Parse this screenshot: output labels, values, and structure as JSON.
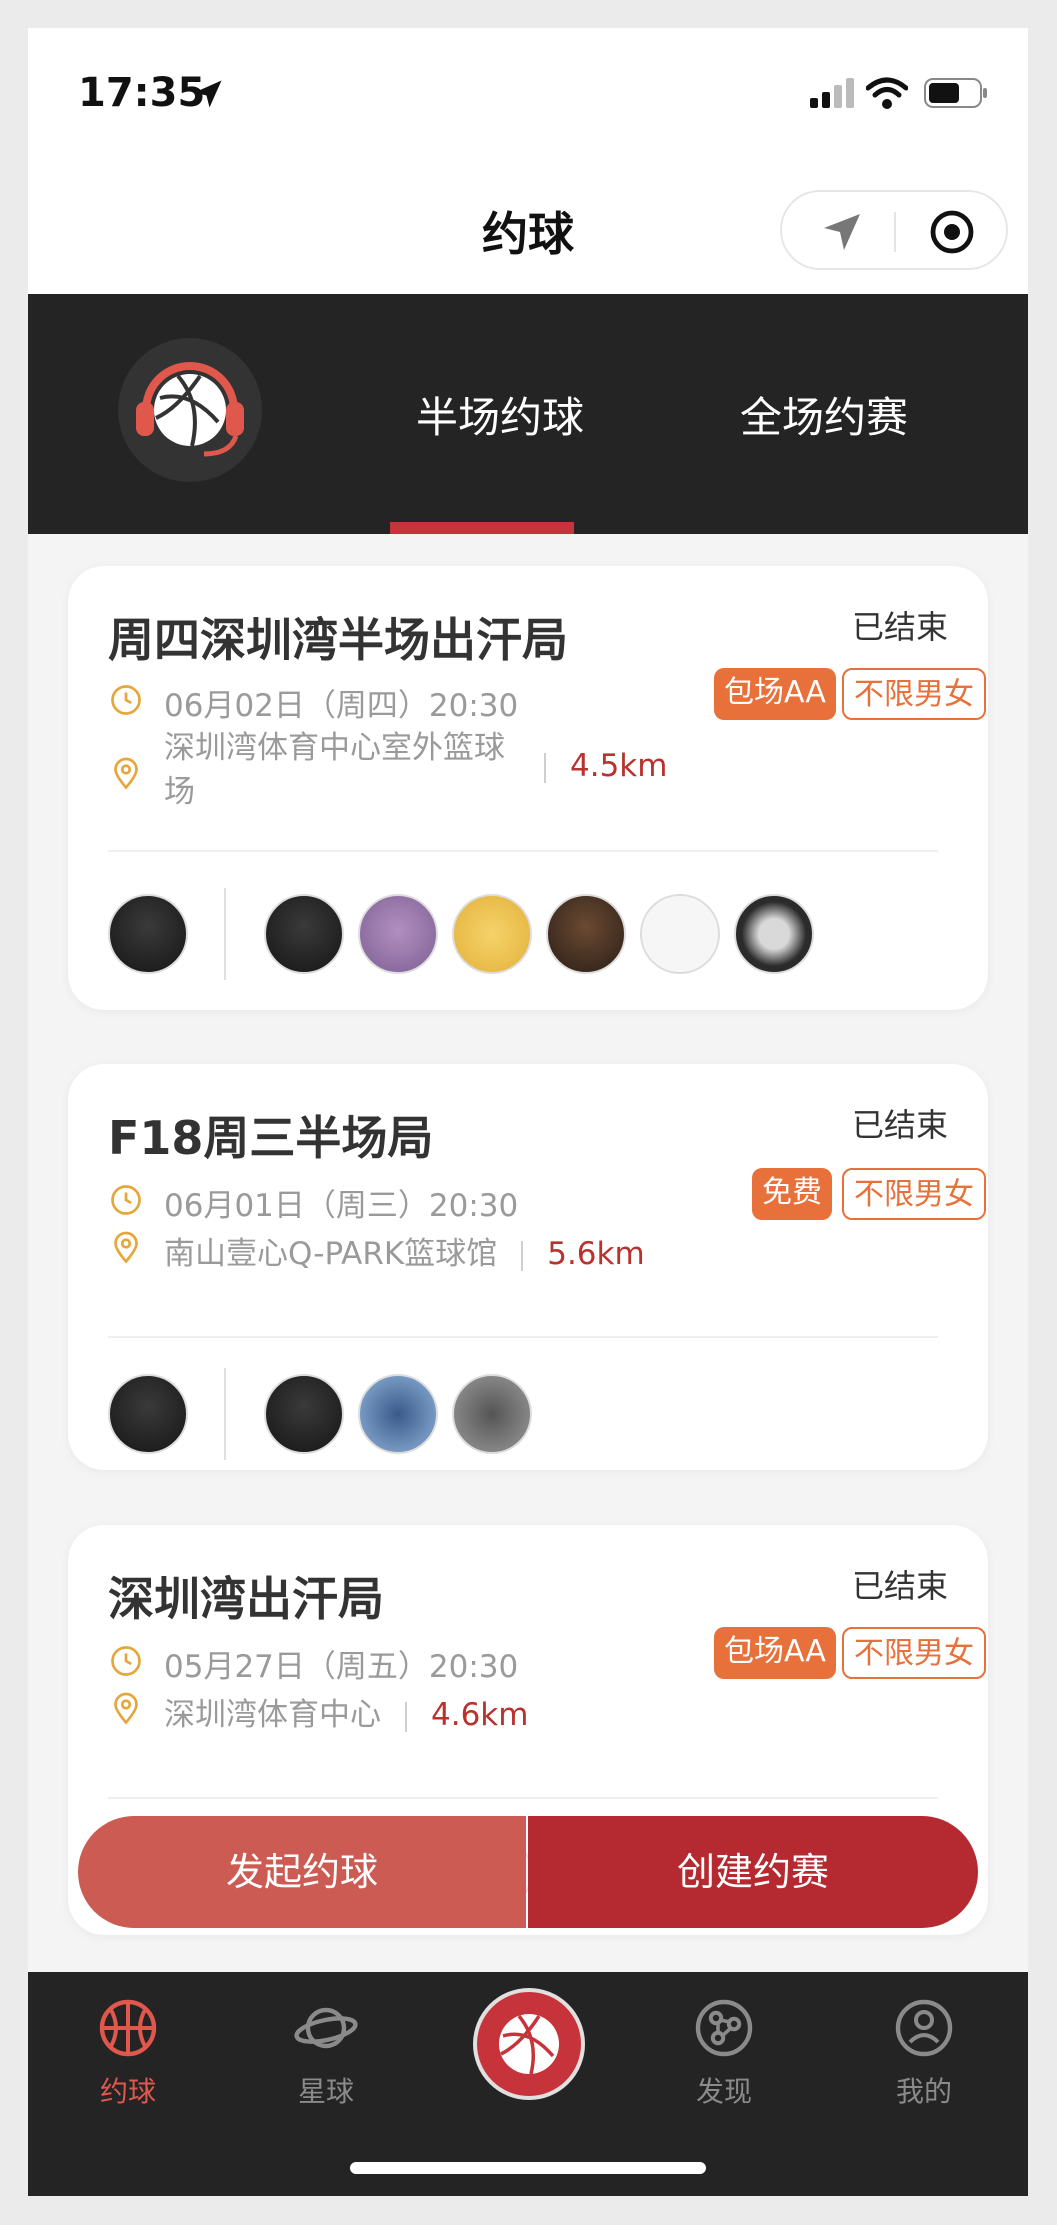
{
  "status_bar": {
    "time": "17:35"
  },
  "nav": {
    "title": "约球"
  },
  "tabs": [
    {
      "label": "半场约球",
      "active": true
    },
    {
      "label": "全场约赛",
      "active": false
    }
  ],
  "cards": [
    {
      "title": "周四深圳湾半场出汗局",
      "status": "已结束",
      "tags": [
        "包场AA",
        "不限男女"
      ],
      "datetime": "06月02日（周四）20:30",
      "address": "深圳湾体育中心室外篮球场",
      "distance": "4.5km"
    },
    {
      "title": "F18周三半场局",
      "status": "已结束",
      "tags": [
        "免费",
        "不限男女"
      ],
      "datetime": "06月01日（周三）20:30",
      "address": "南山壹心Q-PARK篮球馆",
      "distance": "5.6km"
    },
    {
      "title": "深圳湾出汗局",
      "status": "已结束",
      "tags": [
        "包场AA",
        "不限男女"
      ],
      "datetime": "05月27日（周五）20:30",
      "address": "深圳湾体育中心",
      "distance": "4.6km"
    }
  ],
  "actions": {
    "start_game": "发起约球",
    "create_match": "创建约赛"
  },
  "tabbar": [
    {
      "label": "约球",
      "icon": "basketball-icon",
      "active": true
    },
    {
      "label": "星球",
      "icon": "planet-icon",
      "active": false
    },
    {
      "label": "",
      "icon": "basketball-logo-icon",
      "active": false
    },
    {
      "label": "发现",
      "icon": "discover-icon",
      "active": false
    },
    {
      "label": "我的",
      "icon": "profile-icon",
      "active": false
    }
  ],
  "colors": {
    "accent": "#c7333a",
    "tag_orange": "#e8703a",
    "distance_red": "#b8322e",
    "header_dark": "#242424"
  }
}
